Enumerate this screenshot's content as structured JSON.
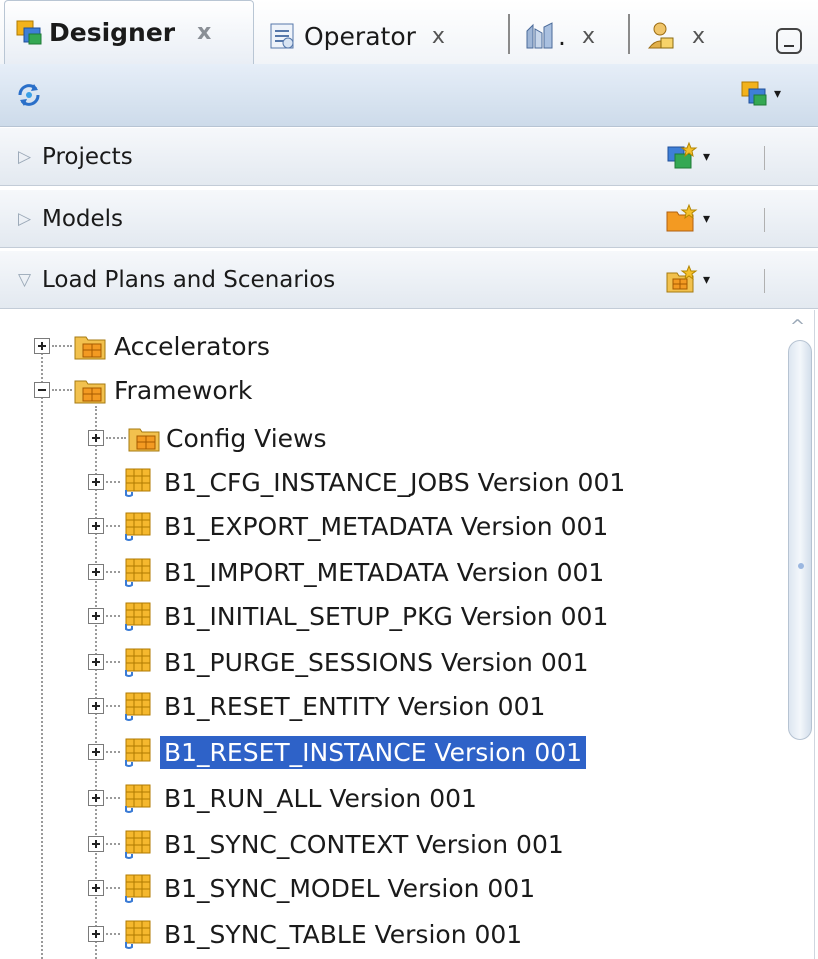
{
  "tabs": [
    {
      "label": "Designer",
      "close": "x",
      "active": true,
      "icon": "designer-icon"
    },
    {
      "label": "Operator",
      "close": "x",
      "active": false,
      "icon": "operator-icon"
    },
    {
      "label": ".",
      "close": "x",
      "active": false,
      "icon": "topology-icon"
    },
    {
      "label": "",
      "close": "x",
      "active": false,
      "icon": "security-icon"
    }
  ],
  "toolbar": {
    "left_icon": "refresh-icon",
    "right_icon": "designer-menu-icon"
  },
  "accordion": [
    {
      "label": "Projects",
      "expanded": false,
      "icon": "new-project-icon"
    },
    {
      "label": "Models",
      "expanded": false,
      "icon": "new-model-folder-icon"
    },
    {
      "label": "Load Plans and Scenarios",
      "expanded": true,
      "icon": "new-scenario-folder-icon"
    }
  ],
  "tree": {
    "folders": [
      {
        "label": "Accelerators",
        "expanded": false
      },
      {
        "label": "Framework",
        "expanded": true
      }
    ],
    "subfolder": {
      "label": "Config Views",
      "expanded": false
    },
    "scenarios": [
      {
        "label": "B1_CFG_INSTANCE_JOBS Version 001",
        "selected": false
      },
      {
        "label": "B1_EXPORT_METADATA Version 001",
        "selected": false
      },
      {
        "label": "B1_IMPORT_METADATA Version 001",
        "selected": false
      },
      {
        "label": "B1_INITIAL_SETUP_PKG Version 001",
        "selected": false
      },
      {
        "label": "B1_PURGE_SESSIONS Version 001",
        "selected": false
      },
      {
        "label": "B1_RESET_ENTITY Version 001",
        "selected": false
      },
      {
        "label": "B1_RESET_INSTANCE Version 001",
        "selected": true
      },
      {
        "label": "B1_RUN_ALL Version 001",
        "selected": false
      },
      {
        "label": "B1_SYNC_CONTEXT Version 001",
        "selected": false
      },
      {
        "label": "B1_SYNC_MODEL Version 001",
        "selected": false
      },
      {
        "label": "B1_SYNC_TABLE Version 001",
        "selected": false
      }
    ]
  },
  "colors": {
    "selection": "#2e62c8",
    "header_bg": "#e3e9f0",
    "toolbar_bg": "#cddbea"
  }
}
